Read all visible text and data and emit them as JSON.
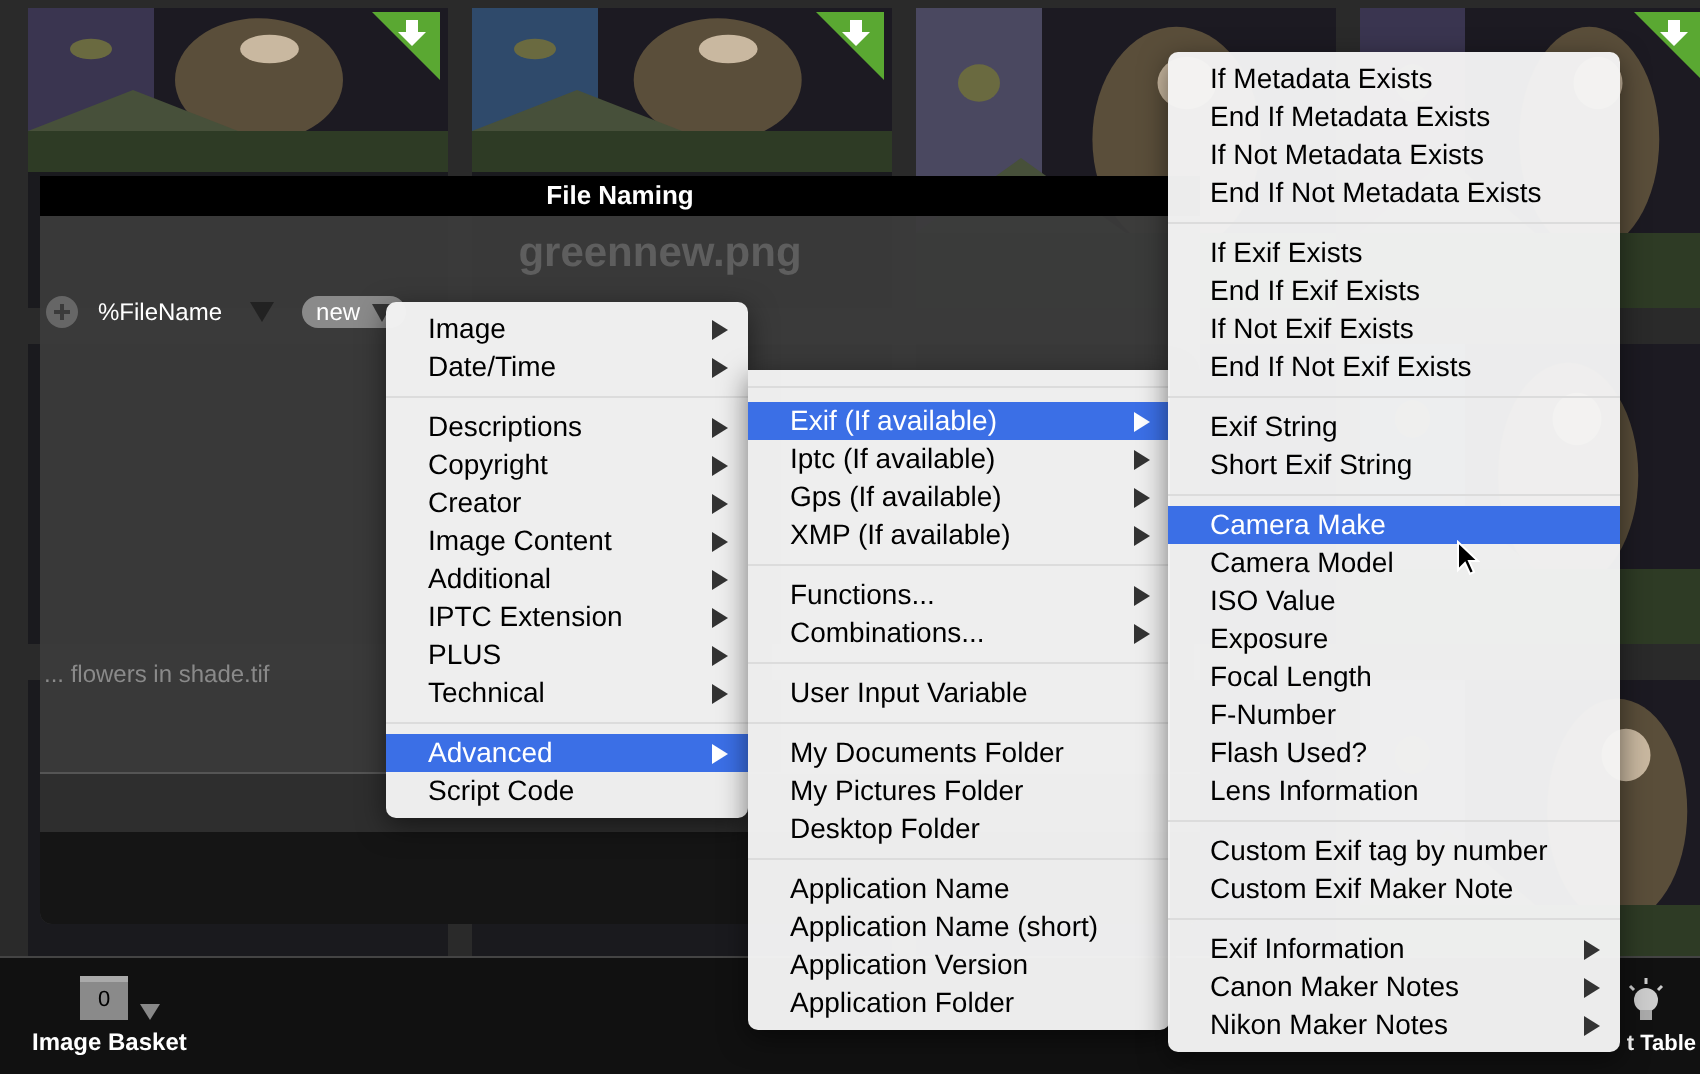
{
  "dialog": {
    "title": "File Naming",
    "filename": "greennew.png",
    "token": "%FileName",
    "pill": "new",
    "faint_name": "... flowers in shade.tif"
  },
  "toolbar": {
    "basket_count": "0",
    "basket_label": "Image Basket",
    "right_label": "t Table"
  },
  "menus": [
    {
      "groups": [
        [
          {
            "label": "Image",
            "submenu": true,
            "selected": false
          },
          {
            "label": "Date/Time",
            "submenu": true,
            "selected": false
          }
        ],
        [
          {
            "label": "Descriptions",
            "submenu": true,
            "selected": false
          },
          {
            "label": "Copyright",
            "submenu": true,
            "selected": false
          },
          {
            "label": "Creator",
            "submenu": true,
            "selected": false
          },
          {
            "label": "Image Content",
            "submenu": true,
            "selected": false
          },
          {
            "label": "Additional",
            "submenu": true,
            "selected": false
          },
          {
            "label": "IPTC Extension",
            "submenu": true,
            "selected": false
          },
          {
            "label": "PLUS",
            "submenu": true,
            "selected": false
          },
          {
            "label": "Technical",
            "submenu": true,
            "selected": false
          }
        ],
        [
          {
            "label": "Advanced",
            "submenu": true,
            "selected": true
          },
          {
            "label": "Script Code",
            "submenu": false,
            "selected": false
          }
        ]
      ]
    },
    {
      "top_separator": true,
      "groups": [
        [
          {
            "label": "Exif (If available)",
            "submenu": true,
            "selected": true
          },
          {
            "label": "Iptc (If available)",
            "submenu": true,
            "selected": false
          },
          {
            "label": "Gps (If available)",
            "submenu": true,
            "selected": false
          },
          {
            "label": "XMP (If available)",
            "submenu": true,
            "selected": false
          }
        ],
        [
          {
            "label": "Functions...",
            "submenu": true,
            "selected": false
          },
          {
            "label": "Combinations...",
            "submenu": true,
            "selected": false
          }
        ],
        [
          {
            "label": "User Input Variable",
            "submenu": false,
            "selected": false
          }
        ],
        [
          {
            "label": "My Documents Folder",
            "submenu": false,
            "selected": false
          },
          {
            "label": "My Pictures Folder",
            "submenu": false,
            "selected": false
          },
          {
            "label": "Desktop Folder",
            "submenu": false,
            "selected": false
          }
        ],
        [
          {
            "label": "Application Name",
            "submenu": false,
            "selected": false
          },
          {
            "label": "Application Name (short)",
            "submenu": false,
            "selected": false
          },
          {
            "label": "Application Version",
            "submenu": false,
            "selected": false
          },
          {
            "label": "Application Folder",
            "submenu": false,
            "selected": false
          }
        ]
      ]
    },
    {
      "groups": [
        [
          {
            "label": "If Metadata Exists",
            "submenu": false,
            "selected": false
          },
          {
            "label": "End If Metadata Exists",
            "submenu": false,
            "selected": false
          },
          {
            "label": "If Not Metadata Exists",
            "submenu": false,
            "selected": false
          },
          {
            "label": "End If Not Metadata Exists",
            "submenu": false,
            "selected": false
          }
        ],
        [
          {
            "label": "If Exif Exists",
            "submenu": false,
            "selected": false
          },
          {
            "label": "End If Exif Exists",
            "submenu": false,
            "selected": false
          },
          {
            "label": "If Not Exif Exists",
            "submenu": false,
            "selected": false
          },
          {
            "label": "End If Not Exif Exists",
            "submenu": false,
            "selected": false
          }
        ],
        [
          {
            "label": "Exif String",
            "submenu": false,
            "selected": false
          },
          {
            "label": "Short Exif String",
            "submenu": false,
            "selected": false
          }
        ],
        [
          {
            "label": "Camera Make",
            "submenu": false,
            "selected": true
          },
          {
            "label": "Camera Model",
            "submenu": false,
            "selected": false
          },
          {
            "label": "ISO Value",
            "submenu": false,
            "selected": false
          },
          {
            "label": "Exposure",
            "submenu": false,
            "selected": false
          },
          {
            "label": "Focal Length",
            "submenu": false,
            "selected": false
          },
          {
            "label": "F-Number",
            "submenu": false,
            "selected": false
          },
          {
            "label": "Flash Used?",
            "submenu": false,
            "selected": false
          },
          {
            "label": "Lens Information",
            "submenu": false,
            "selected": false
          }
        ],
        [
          {
            "label": "Custom Exif tag by number",
            "submenu": false,
            "selected": false
          },
          {
            "label": "Custom Exif Maker Note",
            "submenu": false,
            "selected": false
          }
        ],
        [
          {
            "label": "Exif Information",
            "submenu": true,
            "selected": false
          },
          {
            "label": "Canon Maker Notes",
            "submenu": true,
            "selected": false
          },
          {
            "label": "Nikon Maker Notes",
            "submenu": true,
            "selected": false
          }
        ]
      ]
    }
  ]
}
